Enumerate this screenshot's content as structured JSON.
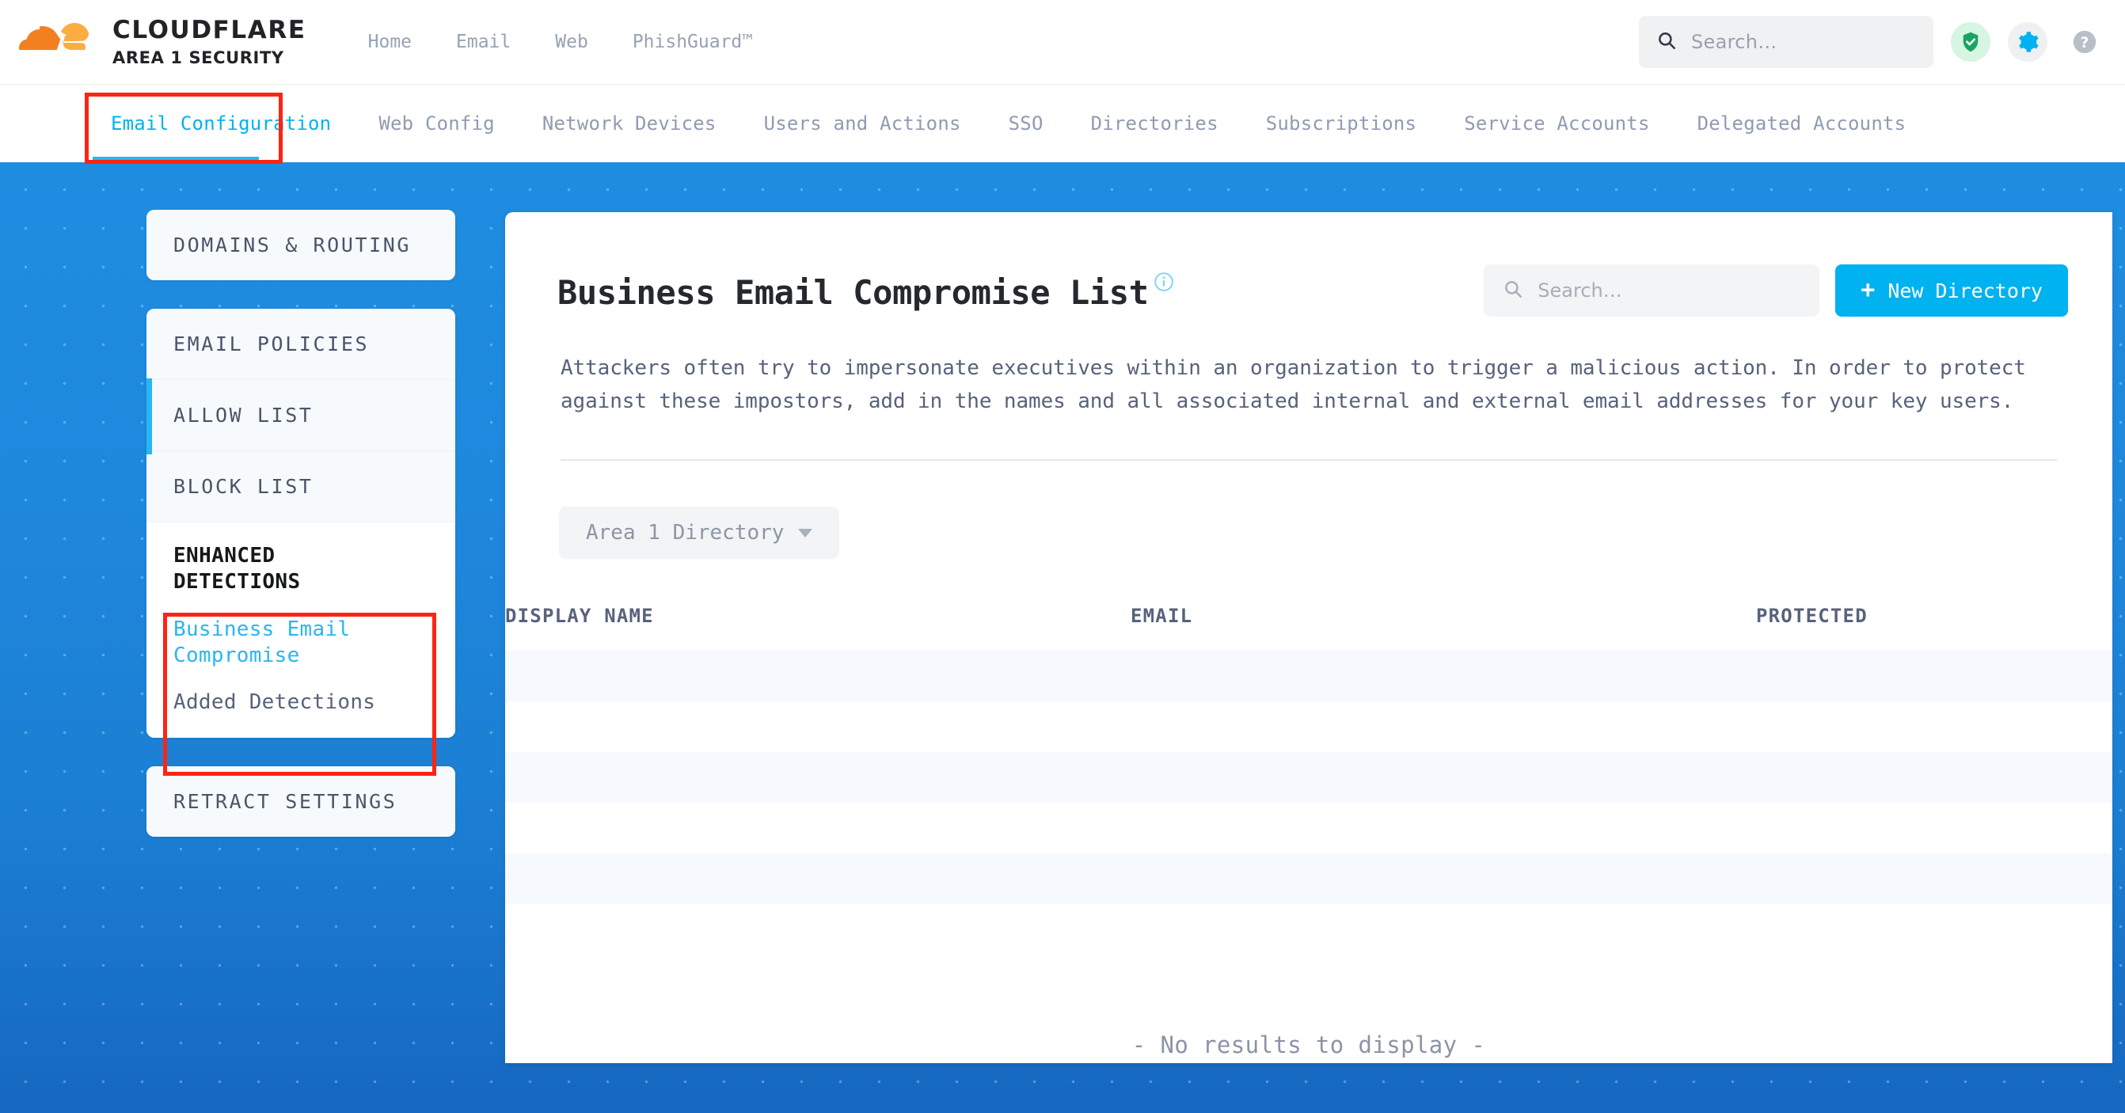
{
  "brand": {
    "logo_icon": "cloudflare-cloud-logo",
    "title": "CLOUDFLARE",
    "subtitle": "AREA 1 SECURITY"
  },
  "topnav": {
    "items": [
      {
        "label": "Home"
      },
      {
        "label": "Email"
      },
      {
        "label": "Web"
      },
      {
        "label": "PhishGuard™"
      }
    ]
  },
  "topbar_right": {
    "search": {
      "placeholder": "Search…",
      "value": "",
      "icon": "search-icon"
    },
    "shield_icon": "shield-check-icon",
    "gear_icon": "gear-icon",
    "help_icon": "help-circle-icon"
  },
  "subnav": {
    "items": [
      {
        "label": "Email Configuration",
        "active": true
      },
      {
        "label": "Web Config",
        "active": false
      },
      {
        "label": "Network Devices",
        "active": false
      },
      {
        "label": "Users and Actions",
        "active": false
      },
      {
        "label": "SSO",
        "active": false
      },
      {
        "label": "Directories",
        "active": false
      },
      {
        "label": "Subscriptions",
        "active": false
      },
      {
        "label": "Service Accounts",
        "active": false
      },
      {
        "label": "Delegated Accounts",
        "active": false
      }
    ]
  },
  "sidebar": {
    "group1": [
      {
        "label": "DOMAINS & ROUTING"
      }
    ],
    "group2": [
      {
        "label": "EMAIL POLICIES"
      },
      {
        "label": "ALLOW LIST"
      },
      {
        "label": "BLOCK LIST"
      }
    ],
    "enhanced": {
      "heading": "ENHANCED DETECTIONS",
      "active_item": "Business Email Compromise",
      "item2": "Added Detections"
    },
    "group3": [
      {
        "label": "RETRACT SETTINGS"
      }
    ]
  },
  "main": {
    "title": "Business Email Compromise List",
    "info_icon": "info-circle-icon",
    "search": {
      "placeholder": "Search…",
      "value": "",
      "icon": "search-icon"
    },
    "new_directory_button": "New Directory",
    "new_directory_icon": "plus-icon",
    "description": "Attackers often try to impersonate executives within an organization to trigger a malicious action. In order to protect against these impostors, add in the names and all associated internal and external email addresses for your key users.",
    "directory_filter": {
      "label": "Area 1 Directory",
      "caret_icon": "chevron-down-icon"
    },
    "table": {
      "columns": [
        "DISPLAY NAME",
        "EMAIL",
        "PROTECTED"
      ],
      "rows": [],
      "empty_message": "- No results to display -"
    }
  },
  "colors": {
    "accent_cyan": "#00b2ef",
    "brand_orange": "#f38020",
    "brand_orange_light": "#fbad41",
    "page_blue": "#1e88dd",
    "annotation_red": "#fb2415",
    "text_slate": "#58627a"
  }
}
